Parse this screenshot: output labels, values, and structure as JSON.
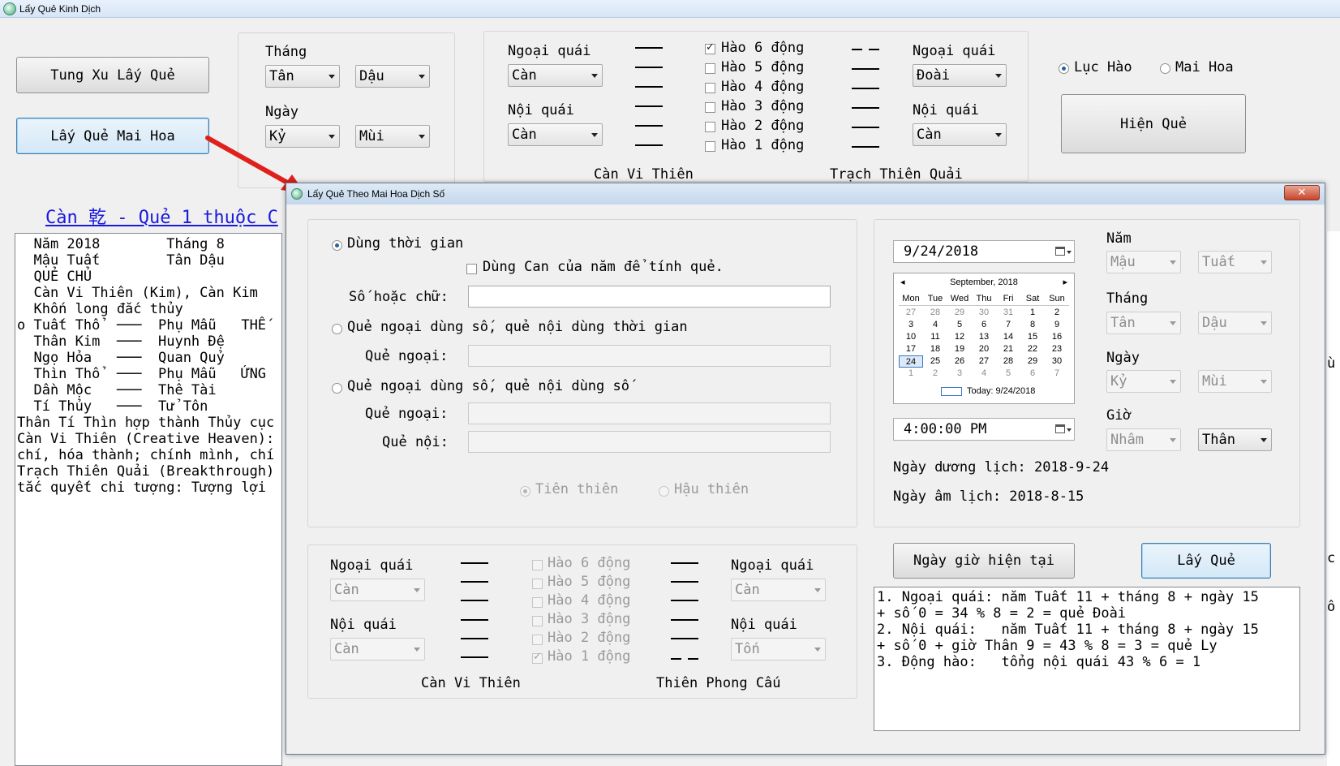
{
  "window": {
    "title": "Lấy Quẻ Kinh Dịch"
  },
  "left_buttons": {
    "tung_xu": "Tung Xu Lấy Quẻ",
    "mai_hoa": "Lấy Quẻ Mai Hoa"
  },
  "date_group": {
    "thang_label": "Tháng",
    "thang_can": "Tân",
    "thang_chi": "Dậu",
    "ngay_label": "Ngày",
    "ngay_can": "Kỷ",
    "ngay_chi": "Mùi"
  },
  "hexagram_group": {
    "ngoai_label_l": "Ngoại quái",
    "ngoai_value_l": "Càn",
    "noi_label_l": "Nội quái",
    "noi_value_l": "Càn",
    "hao_labels": [
      "Hào 6 động",
      "Hào 5 động",
      "Hào 4 động",
      "Hào 3 động",
      "Hào 2 động",
      "Hào 1 động"
    ],
    "ngoai_label_r": "Ngoại quái",
    "ngoai_value_r": "Đoài",
    "noi_label_r": "Nội quái",
    "noi_value_r": "Càn",
    "name_left": "Càn Vi Thiên",
    "name_right": "Trạch Thiên Quải"
  },
  "mode": {
    "luc_hao": "Lục Hào",
    "mai_hoa": "Mai Hoa",
    "hien_que": "Hiện Quẻ"
  },
  "heading": "Càn 乾 - Quẻ 1 thuộc C",
  "main_lines": [
    "  Năm 2018        Tháng 8",
    "  Mậu Tuất        Tân Dậu",
    "",
    "  QUẺ CHỦ",
    "  Càn Vi Thiên (Kim), Càn Kim",
    "  Khốn long đắc thủy",
    "",
    "o Tuất Thổ  ───  Phụ Mẫu   THẾ",
    "  Thân Kim  ───  Huynh Đệ",
    "  Ngọ Hỏa   ───  Quan Quỷ",
    "  Thìn Thổ  ───  Phụ Mẫu   ỨNG",
    "  Dần Mộc   ───  Thê Tài",
    "  Tí Thủy   ───  Tử Tôn",
    "",
    "",
    "",
    "Thân Tí Thìn hợp thành Thủy cục",
    "",
    "Càn Vi Thiên (Creative Heaven):",
    "chí, hóa thành; chính mình, chí",
    "",
    "Trạch Thiên Quải (Breakthrough)",
    "tắc quyết chi tượng: Tượng lợi"
  ],
  "right_edge": {
    "r1": "ù",
    "r2": "c",
    "r3": "ô"
  },
  "dialog": {
    "title": "Lấy Quẻ Theo Mai Hoa Dịch Số",
    "close": "✕",
    "opt_time": "Dùng thời gian",
    "use_can": "Dùng Can của năm để tính quẻ.",
    "so_hoac_chu": "Số hoặc chữ:",
    "opt_outer_num": "Quẻ ngoại dùng số, quẻ nội dùng thời gian",
    "que_ngoai": "Quẻ ngoại:",
    "opt_both_num": "Quẻ ngoại dùng số, quẻ nội dùng số",
    "que_ngoai2": "Quẻ ngoại:",
    "que_noi": "Quẻ nội:",
    "tien_thien": "Tiên thiên",
    "hau_thien": "Hậu thiên",
    "date_value": "9/24/2018",
    "time_value": "4:00:00 PM",
    "nam_label": "Năm",
    "nam_can": "Mậu",
    "nam_chi": "Tuất",
    "thang_label": "Tháng",
    "thang_can": "Tân",
    "thang_chi": "Dậu",
    "ngay_label": "Ngày",
    "ngay_can": "Kỷ",
    "ngay_chi": "Mùi",
    "gio_label": "Giờ",
    "gio_can": "Nhâm",
    "gio_chi": "Thân",
    "duong_lich": "Ngày dương lịch: 2018-9-24",
    "am_lich": "Ngày âm lịch: 2018-8-15",
    "now_button": "Ngày giờ hiện tại",
    "lay_que": "Lấy Quẻ",
    "calendar": {
      "month": "September, 2018",
      "weekdays": [
        "Mon",
        "Tue",
        "Wed",
        "Thu",
        "Fri",
        "Sat",
        "Sun"
      ],
      "days": [
        "27",
        "28",
        "29",
        "30",
        "31",
        "1",
        "2",
        "3",
        "4",
        "5",
        "6",
        "7",
        "8",
        "9",
        "10",
        "11",
        "12",
        "13",
        "14",
        "15",
        "16",
        "17",
        "18",
        "19",
        "20",
        "21",
        "22",
        "23",
        "24",
        "25",
        "26",
        "27",
        "28",
        "29",
        "30",
        "1",
        "2",
        "3",
        "4",
        "5",
        "6",
        "7"
      ],
      "today": "Today: 9/24/2018"
    },
    "bottom": {
      "ngoai_label_l": "Ngoại quái",
      "ngoai_value_l": "Càn",
      "noi_label_l": "Nội quái",
      "noi_value_l": "Càn",
      "hao_labels": [
        "Hào 6 động",
        "Hào 5 động",
        "Hào 4 động",
        "Hào 3 động",
        "Hào 2 động",
        "Hào 1 động"
      ],
      "ngoai_label_r": "Ngoại quái",
      "ngoai_value_r": "Càn",
      "noi_label_r": "Nội quái",
      "noi_value_r": "Tốn",
      "name_left": "Càn Vi Thiên",
      "name_right": "Thiên Phong Cấu"
    },
    "result_lines": [
      "1. Ngoại quái: năm Tuất 11 + tháng 8 + ngày 15",
      "+ số 0 = 34 % 8 = 2 = quẻ Đoài",
      "",
      "2. Nội quái:   năm Tuất 11 + tháng 8 + ngày 15",
      "+ số 0 + giờ Thân 9 = 43 % 8 = 3 = quẻ Ly",
      "",
      "3. Động hào:   tổng nội quái 43 % 6 = 1"
    ]
  },
  "colors": {
    "heading": "#1a1adc",
    "arrow": "#e0201c"
  }
}
